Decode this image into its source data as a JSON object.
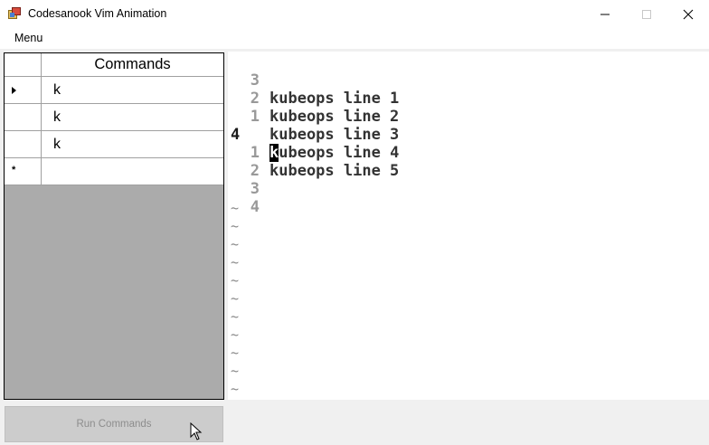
{
  "window": {
    "title": "Codesanook Vim Animation",
    "icons": [
      "app-icon",
      "minimize-icon",
      "maximize-icon",
      "close-icon"
    ]
  },
  "menu": {
    "items": [
      "Menu"
    ]
  },
  "grid": {
    "header": "Commands",
    "rows": [
      {
        "value": "k",
        "marker": "current-row-arrow"
      },
      {
        "value": "k",
        "marker": ""
      },
      {
        "value": "k",
        "marker": ""
      },
      {
        "value": "",
        "marker": "*"
      }
    ]
  },
  "run_button": {
    "label": "Run Commands",
    "enabled": false
  },
  "editor": {
    "lines": [
      {
        "number": "3",
        "text": "kubeops line 1",
        "current": false
      },
      {
        "number": "2",
        "text": "kubeops line 2",
        "current": false
      },
      {
        "number": "1",
        "text": "kubeops line 3",
        "current": false
      },
      {
        "number": "4",
        "text": "kubeops line 4",
        "current": true,
        "cursor_char": "k",
        "rest": "ubeops line 4"
      },
      {
        "number": "1",
        "text": "kubeops line 5",
        "current": false
      },
      {
        "number": "2",
        "text": "",
        "current": false
      },
      {
        "number": "3",
        "text": "",
        "current": false
      },
      {
        "number": "4",
        "text": "",
        "current": false
      }
    ],
    "tilde": "~",
    "tilde_count": 11
  },
  "colors": {
    "grid_background": "#ababab",
    "editor_background": "#ffffff",
    "line_number": "#999999",
    "cursor_bg": "#000000"
  }
}
